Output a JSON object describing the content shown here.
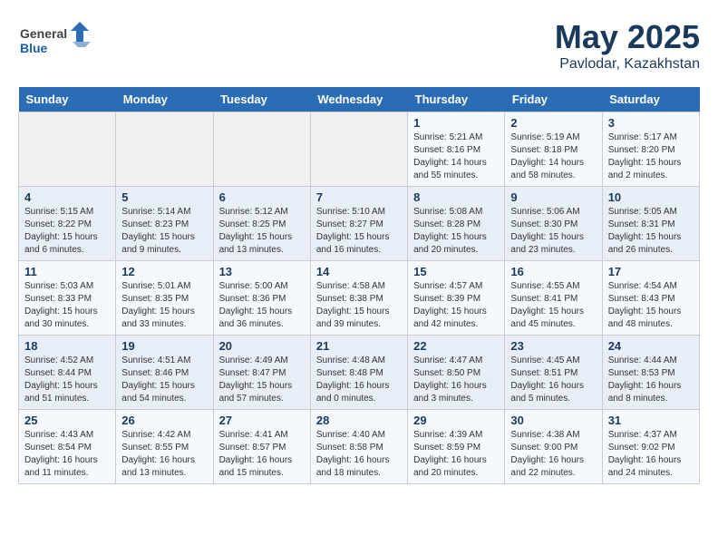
{
  "header": {
    "logo_general": "General",
    "logo_blue": "Blue",
    "month": "May 2025",
    "location": "Pavlodar, Kazakhstan"
  },
  "days_of_week": [
    "Sunday",
    "Monday",
    "Tuesday",
    "Wednesday",
    "Thursday",
    "Friday",
    "Saturday"
  ],
  "weeks": [
    [
      {
        "day": "",
        "details": ""
      },
      {
        "day": "",
        "details": ""
      },
      {
        "day": "",
        "details": ""
      },
      {
        "day": "",
        "details": ""
      },
      {
        "day": "1",
        "details": "Sunrise: 5:21 AM\nSunset: 8:16 PM\nDaylight: 14 hours\nand 55 minutes."
      },
      {
        "day": "2",
        "details": "Sunrise: 5:19 AM\nSunset: 8:18 PM\nDaylight: 14 hours\nand 58 minutes."
      },
      {
        "day": "3",
        "details": "Sunrise: 5:17 AM\nSunset: 8:20 PM\nDaylight: 15 hours\nand 2 minutes."
      }
    ],
    [
      {
        "day": "4",
        "details": "Sunrise: 5:15 AM\nSunset: 8:22 PM\nDaylight: 15 hours\nand 6 minutes."
      },
      {
        "day": "5",
        "details": "Sunrise: 5:14 AM\nSunset: 8:23 PM\nDaylight: 15 hours\nand 9 minutes."
      },
      {
        "day": "6",
        "details": "Sunrise: 5:12 AM\nSunset: 8:25 PM\nDaylight: 15 hours\nand 13 minutes."
      },
      {
        "day": "7",
        "details": "Sunrise: 5:10 AM\nSunset: 8:27 PM\nDaylight: 15 hours\nand 16 minutes."
      },
      {
        "day": "8",
        "details": "Sunrise: 5:08 AM\nSunset: 8:28 PM\nDaylight: 15 hours\nand 20 minutes."
      },
      {
        "day": "9",
        "details": "Sunrise: 5:06 AM\nSunset: 8:30 PM\nDaylight: 15 hours\nand 23 minutes."
      },
      {
        "day": "10",
        "details": "Sunrise: 5:05 AM\nSunset: 8:31 PM\nDaylight: 15 hours\nand 26 minutes."
      }
    ],
    [
      {
        "day": "11",
        "details": "Sunrise: 5:03 AM\nSunset: 8:33 PM\nDaylight: 15 hours\nand 30 minutes."
      },
      {
        "day": "12",
        "details": "Sunrise: 5:01 AM\nSunset: 8:35 PM\nDaylight: 15 hours\nand 33 minutes."
      },
      {
        "day": "13",
        "details": "Sunrise: 5:00 AM\nSunset: 8:36 PM\nDaylight: 15 hours\nand 36 minutes."
      },
      {
        "day": "14",
        "details": "Sunrise: 4:58 AM\nSunset: 8:38 PM\nDaylight: 15 hours\nand 39 minutes."
      },
      {
        "day": "15",
        "details": "Sunrise: 4:57 AM\nSunset: 8:39 PM\nDaylight: 15 hours\nand 42 minutes."
      },
      {
        "day": "16",
        "details": "Sunrise: 4:55 AM\nSunset: 8:41 PM\nDaylight: 15 hours\nand 45 minutes."
      },
      {
        "day": "17",
        "details": "Sunrise: 4:54 AM\nSunset: 8:43 PM\nDaylight: 15 hours\nand 48 minutes."
      }
    ],
    [
      {
        "day": "18",
        "details": "Sunrise: 4:52 AM\nSunset: 8:44 PM\nDaylight: 15 hours\nand 51 minutes."
      },
      {
        "day": "19",
        "details": "Sunrise: 4:51 AM\nSunset: 8:46 PM\nDaylight: 15 hours\nand 54 minutes."
      },
      {
        "day": "20",
        "details": "Sunrise: 4:49 AM\nSunset: 8:47 PM\nDaylight: 15 hours\nand 57 minutes."
      },
      {
        "day": "21",
        "details": "Sunrise: 4:48 AM\nSunset: 8:48 PM\nDaylight: 16 hours\nand 0 minutes."
      },
      {
        "day": "22",
        "details": "Sunrise: 4:47 AM\nSunset: 8:50 PM\nDaylight: 16 hours\nand 3 minutes."
      },
      {
        "day": "23",
        "details": "Sunrise: 4:45 AM\nSunset: 8:51 PM\nDaylight: 16 hours\nand 5 minutes."
      },
      {
        "day": "24",
        "details": "Sunrise: 4:44 AM\nSunset: 8:53 PM\nDaylight: 16 hours\nand 8 minutes."
      }
    ],
    [
      {
        "day": "25",
        "details": "Sunrise: 4:43 AM\nSunset: 8:54 PM\nDaylight: 16 hours\nand 11 minutes."
      },
      {
        "day": "26",
        "details": "Sunrise: 4:42 AM\nSunset: 8:55 PM\nDaylight: 16 hours\nand 13 minutes."
      },
      {
        "day": "27",
        "details": "Sunrise: 4:41 AM\nSunset: 8:57 PM\nDaylight: 16 hours\nand 15 minutes."
      },
      {
        "day": "28",
        "details": "Sunrise: 4:40 AM\nSunset: 8:58 PM\nDaylight: 16 hours\nand 18 minutes."
      },
      {
        "day": "29",
        "details": "Sunrise: 4:39 AM\nSunset: 8:59 PM\nDaylight: 16 hours\nand 20 minutes."
      },
      {
        "day": "30",
        "details": "Sunrise: 4:38 AM\nSunset: 9:00 PM\nDaylight: 16 hours\nand 22 minutes."
      },
      {
        "day": "31",
        "details": "Sunrise: 4:37 AM\nSunset: 9:02 PM\nDaylight: 16 hours\nand 24 minutes."
      }
    ]
  ]
}
